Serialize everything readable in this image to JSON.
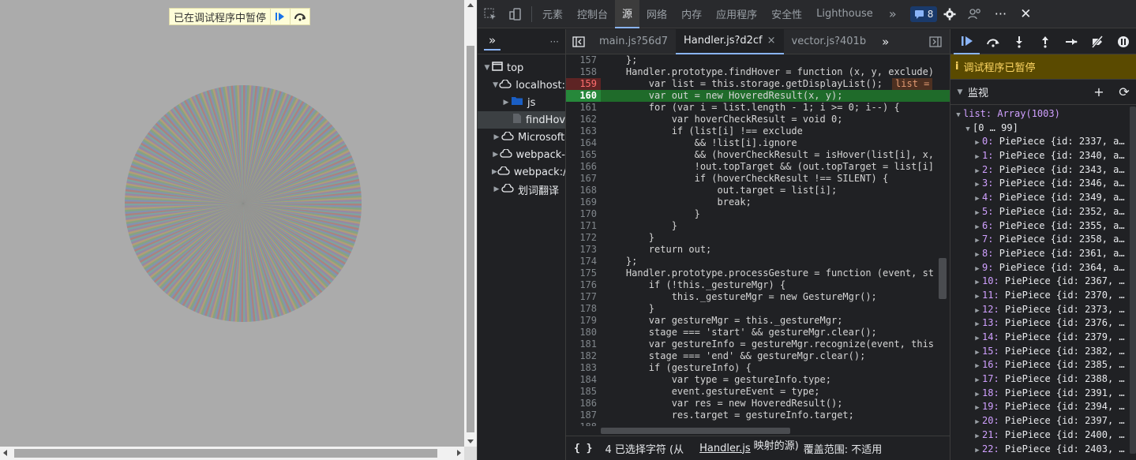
{
  "page": {
    "paused_label": "已在调试程序中暂停",
    "pie_colors": [
      "#e05252",
      "#5b8ff9",
      "#61c45e",
      "#f0b040",
      "#9a6bd1",
      "#49c2c9"
    ]
  },
  "devtools": {
    "panel_tabs": [
      "元素",
      "控制台",
      "源",
      "网络",
      "内存",
      "应用程序",
      "安全性",
      "Lighthouse"
    ],
    "active_panel": "源",
    "issues_count": "8",
    "navigator": {
      "items": [
        {
          "label": "top"
        },
        {
          "label": "localhost:"
        },
        {
          "label": "js"
        },
        {
          "label": "findHov"
        },
        {
          "label": "Microsoft"
        },
        {
          "label": "webpack-"
        },
        {
          "label": "webpack:/"
        },
        {
          "label": "划词翻译"
        }
      ]
    },
    "editor": {
      "tabs": [
        {
          "label": "main.js?56d7"
        },
        {
          "label": "Handler.js?d2cf"
        },
        {
          "label": "vector.js?401b"
        }
      ],
      "inline_value": "list =",
      "lines": [
        {
          "n": "157",
          "code": "    };"
        },
        {
          "n": "158",
          "code": "    Handler.prototype.findHover = function (x, y, exclude)"
        },
        {
          "n": "159",
          "code": "        var list = this.storage.getDisplayList();"
        },
        {
          "n": "160",
          "code": "        var out = new HoveredResult(x, y);"
        },
        {
          "n": "161",
          "code": "        for (var i = list.length - 1; i >= 0; i--) {"
        },
        {
          "n": "162",
          "code": "            var hoverCheckResult = void 0;"
        },
        {
          "n": "163",
          "code": "            if (list[i] !== exclude"
        },
        {
          "n": "164",
          "code": "                && !list[i].ignore"
        },
        {
          "n": "165",
          "code": "                && (hoverCheckResult = isHover(list[i], x,"
        },
        {
          "n": "166",
          "code": "                !out.topTarget && (out.topTarget = list[i]"
        },
        {
          "n": "167",
          "code": "                if (hoverCheckResult !== SILENT) {"
        },
        {
          "n": "168",
          "code": "                    out.target = list[i];"
        },
        {
          "n": "169",
          "code": "                    break;"
        },
        {
          "n": "170",
          "code": "                }"
        },
        {
          "n": "171",
          "code": "            }"
        },
        {
          "n": "172",
          "code": "        }"
        },
        {
          "n": "173",
          "code": "        return out;"
        },
        {
          "n": "174",
          "code": "    };"
        },
        {
          "n": "175",
          "code": "    Handler.prototype.processGesture = function (event, st"
        },
        {
          "n": "176",
          "code": "        if (!this._gestureMgr) {"
        },
        {
          "n": "177",
          "code": "            this._gestureMgr = new GestureMgr();"
        },
        {
          "n": "178",
          "code": "        }"
        },
        {
          "n": "179",
          "code": "        var gestureMgr = this._gestureMgr;"
        },
        {
          "n": "180",
          "code": "        stage === 'start' && gestureMgr.clear();"
        },
        {
          "n": "181",
          "code": "        var gestureInfo = gestureMgr.recognize(event, this"
        },
        {
          "n": "182",
          "code": "        stage === 'end' && gestureMgr.clear();"
        },
        {
          "n": "183",
          "code": "        if (gestureInfo) {"
        },
        {
          "n": "184",
          "code": "            var type = gestureInfo.type;"
        },
        {
          "n": "185",
          "code": "            event.gestureEvent = type;"
        },
        {
          "n": "186",
          "code": "            var res = new HoveredResult();"
        },
        {
          "n": "187",
          "code": "            res.target = gestureInfo.target;"
        },
        {
          "n": "188",
          "code": ""
        }
      ],
      "status": {
        "selected": "4 已选择字符 (从",
        "file_link": "Handler.js",
        "mapped": "映射的源)",
        "coverage": "覆盖范围: 不适用"
      }
    },
    "debugger": {
      "paused_status": "调试程序已暂停",
      "watch_title": "监视",
      "list_label": "list: Array(1003)",
      "range_label": "[0 … 99]",
      "entries": [
        {
          "idx": "0:",
          "val": "PiePiece {id: 2337, a…"
        },
        {
          "idx": "1:",
          "val": "PiePiece {id: 2340, a…"
        },
        {
          "idx": "2:",
          "val": "PiePiece {id: 2343, a…"
        },
        {
          "idx": "3:",
          "val": "PiePiece {id: 2346, a…"
        },
        {
          "idx": "4:",
          "val": "PiePiece {id: 2349, a…"
        },
        {
          "idx": "5:",
          "val": "PiePiece {id: 2352, a…"
        },
        {
          "idx": "6:",
          "val": "PiePiece {id: 2355, a…"
        },
        {
          "idx": "7:",
          "val": "PiePiece {id: 2358, a…"
        },
        {
          "idx": "8:",
          "val": "PiePiece {id: 2361, a…"
        },
        {
          "idx": "9:",
          "val": "PiePiece {id: 2364, a…"
        },
        {
          "idx": "10:",
          "val": "PiePiece {id: 2367, …"
        },
        {
          "idx": "11:",
          "val": "PiePiece {id: 2370, …"
        },
        {
          "idx": "12:",
          "val": "PiePiece {id: 2373, …"
        },
        {
          "idx": "13:",
          "val": "PiePiece {id: 2376, …"
        },
        {
          "idx": "14:",
          "val": "PiePiece {id: 2379, …"
        },
        {
          "idx": "15:",
          "val": "PiePiece {id: 2382, …"
        },
        {
          "idx": "16:",
          "val": "PiePiece {id: 2385, …"
        },
        {
          "idx": "17:",
          "val": "PiePiece {id: 2388, …"
        },
        {
          "idx": "18:",
          "val": "PiePiece {id: 2391, …"
        },
        {
          "idx": "19:",
          "val": "PiePiece {id: 2394, …"
        },
        {
          "idx": "20:",
          "val": "PiePiece {id: 2397, …"
        },
        {
          "idx": "21:",
          "val": "PiePiece {id: 2400, …"
        },
        {
          "idx": "22:",
          "val": "PiePiece {id: 2403, …"
        }
      ]
    }
  }
}
